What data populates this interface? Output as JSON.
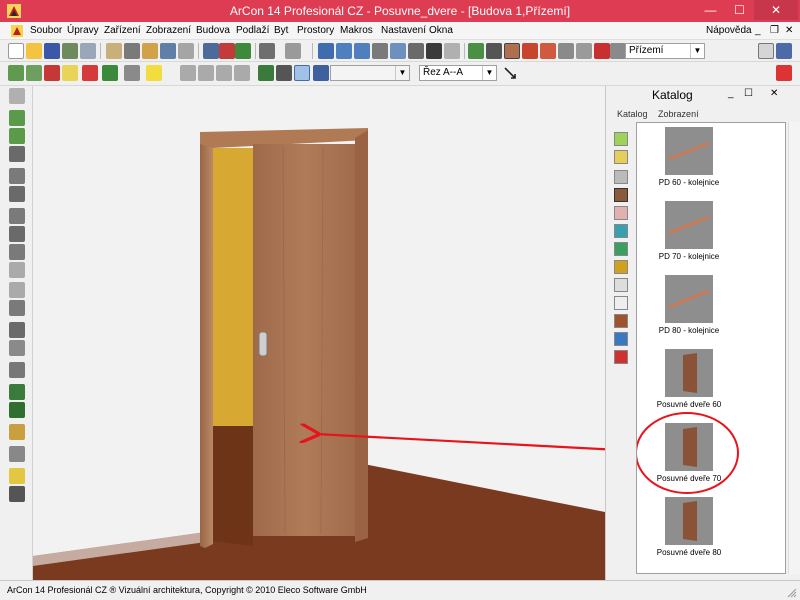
{
  "window": {
    "title": "ArCon 14 Profesionál CZ - Posuvne_dvere - [Budova 1,Přízemí]",
    "minimize": "—",
    "maximize": "☐",
    "close": "✕"
  },
  "menu": {
    "items": [
      "Soubor",
      "Úpravy",
      "Zařízení",
      "Zobrazení",
      "Budova",
      "Podlaží",
      "Byt",
      "Prostory",
      "Makros",
      "Nastavení",
      "Okna"
    ],
    "help": "Nápověda",
    "mdi_minimize": "_",
    "mdi_restore": "❐",
    "mdi_close": "✕"
  },
  "toolbar": {
    "floor_select": "Přízemí",
    "section_select": "Řez A--A",
    "empty_select": ""
  },
  "catalog": {
    "title": "Katalog",
    "tabs": [
      "Katalog",
      "Zobrazení"
    ],
    "items": [
      {
        "label": "PD 60 - kolejnice",
        "kind": "rail"
      },
      {
        "label": "PD 70 - kolejnice",
        "kind": "rail"
      },
      {
        "label": "PD 80 - kolejnice",
        "kind": "rail"
      },
      {
        "label": "Posuvné dveře 60",
        "kind": "door"
      },
      {
        "label": "Posuvné dveře 70",
        "kind": "door"
      },
      {
        "label": "Posuvné dveře 80",
        "kind": "door"
      }
    ]
  },
  "colors": {
    "titlebar": "#dd3c52",
    "wall_yellow": "#d7a932",
    "floor": "#7a3a20",
    "door_wood": "#a5704f",
    "annotation": "#e8141c"
  },
  "status": {
    "text": "ArCon 14 Profesionál CZ ® Vizuální architektura, Copyright © 2010 Eleco Software GmbH"
  }
}
